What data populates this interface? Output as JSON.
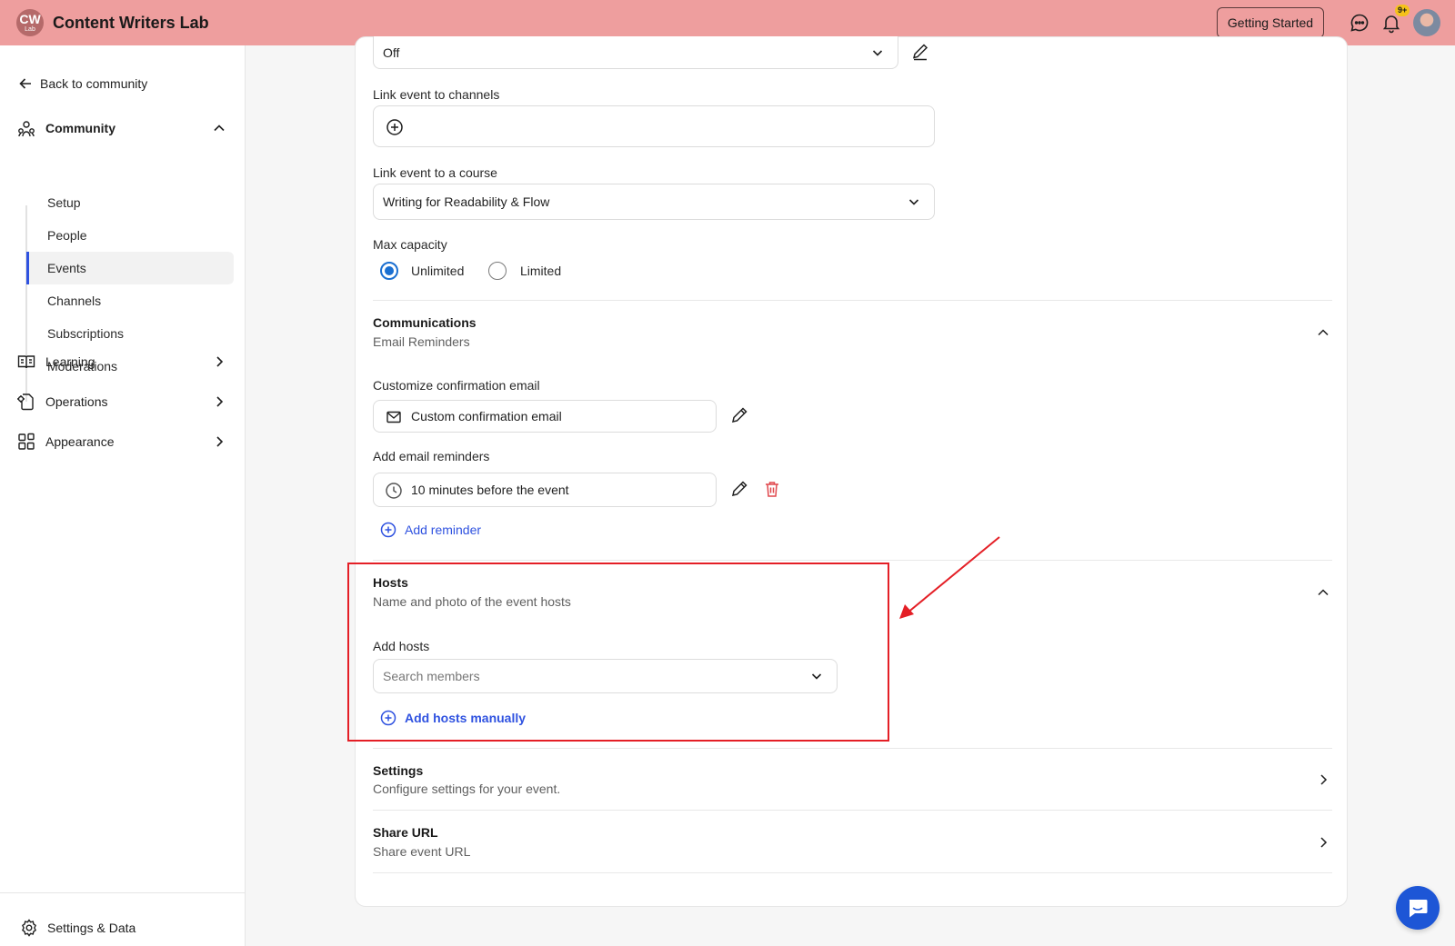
{
  "header": {
    "logo_main": "CW",
    "logo_sub": "Lab",
    "app_title": "Content Writers Lab",
    "getting_started_label": "Getting Started",
    "notifications_badge": "9+"
  },
  "sidebar": {
    "back_label": "Back to community",
    "community_label": "Community",
    "community_items": [
      {
        "label": "Setup"
      },
      {
        "label": "People"
      },
      {
        "label": "Events",
        "active": true
      },
      {
        "label": "Channels"
      },
      {
        "label": "Subscriptions"
      },
      {
        "label": "Moderations"
      }
    ],
    "learning_label": "Learning",
    "operations_label": "Operations",
    "appearance_label": "Appearance",
    "settings_data_label": "Settings & Data"
  },
  "form": {
    "top_select_value": "Off",
    "link_channels_label": "Link event to channels",
    "link_course_label": "Link event to a course",
    "link_course_value": "Writing for Readability & Flow",
    "max_capacity_label": "Max capacity",
    "capacity_options": [
      "Unlimited",
      "Limited"
    ],
    "capacity_selected": "Unlimited"
  },
  "communications": {
    "title": "Communications",
    "subtitle": "Email Reminders",
    "confirm_label": "Customize confirmation email",
    "confirm_value": "Custom confirmation email",
    "reminders_label": "Add email reminders",
    "reminder_value": "10 minutes before the event",
    "add_reminder_label": "Add reminder"
  },
  "hosts": {
    "title": "Hosts",
    "subtitle": "Name and photo of the event hosts",
    "add_hosts_label": "Add hosts",
    "search_placeholder": "Search members",
    "add_manual_label": "Add hosts manually"
  },
  "settings_section": {
    "title": "Settings",
    "subtitle": "Configure settings for your event."
  },
  "share_section": {
    "title": "Share URL",
    "subtitle": "Share event URL"
  },
  "colors": {
    "topbar": "#ee9e9e",
    "accent_blue": "#2f52e0",
    "highlight_red": "#e41f26",
    "delete_red": "#e0474c"
  }
}
